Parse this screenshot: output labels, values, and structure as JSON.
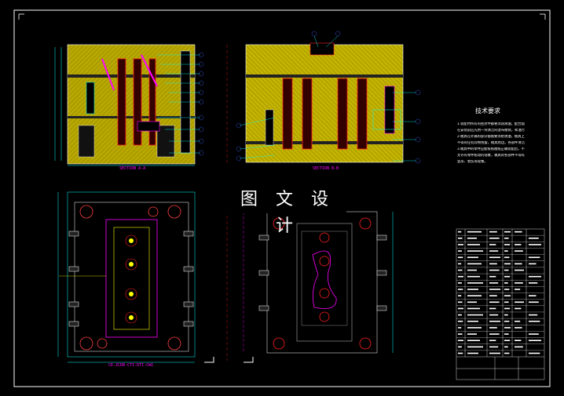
{
  "watermark": "图 文 设 计",
  "section_labels": {
    "top_left": "SECTION A-A",
    "top_right": "SECTION B-B",
    "bottom_left": "CE-ZCDB-CTI-DTI-CWI"
  },
  "tech_requirements": {
    "title": "技术要求",
    "lines": [
      "1.装配时所有的密封件都要涂润滑油，配合面",
      "在安装前应先用一块清洁的湿布擦拭，和油污",
      "2.模具在外漏的部分都需要涂防锈油，模具上",
      "不得有任何异物残留，模具周边，各部件清洁",
      "3.模具中的零件应能按照图纸正确装配后，不",
      "允许有零件松动的现象，模具的各部件不得有",
      "变形、划伤等现象。"
    ]
  },
  "colors": {
    "background": "#000000",
    "frame": "#ffffff",
    "plate_fill": "#b8a800",
    "hatch": "#7a6e00",
    "cyan": "#00ffff",
    "magenta": "#ff00ff",
    "red": "#ff2020",
    "green": "#00ff00",
    "blue": "#4040ff"
  }
}
